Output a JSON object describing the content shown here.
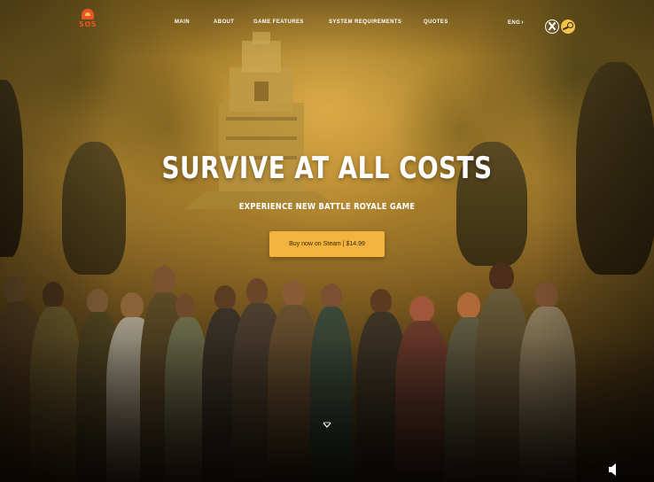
{
  "brand": {
    "logo_text": "SOS"
  },
  "nav": {
    "items": [
      {
        "label": "MAIN"
      },
      {
        "label": "ABOUT"
      },
      {
        "label": "GAME FEATURES"
      },
      {
        "label": "SYSTEM REQUIREMENTS"
      },
      {
        "label": "QUOTES"
      }
    ]
  },
  "language": {
    "label": "ENG",
    "icon": "chevron-right-icon"
  },
  "platforms": [
    {
      "name": "xbox",
      "icon": "xbox-icon"
    },
    {
      "name": "steam",
      "icon": "steam-icon"
    }
  ],
  "hero": {
    "headline": "SURVIVE AT ALL COSTS",
    "subheadline": "EXPERIENCE NEW BATTLE ROYALE GAME",
    "cta_label": "Buy now on Steam | $14.99",
    "scroll_icon": "chevron-down-icon",
    "sound_icon": "speaker-icon"
  },
  "colors": {
    "accent": "#f3b33d",
    "logo": "#e8542a",
    "text": "#ffffff"
  }
}
